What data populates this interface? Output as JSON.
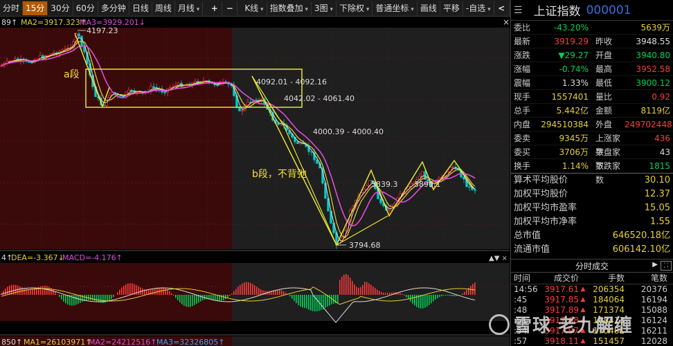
{
  "toolbar": {
    "items": [
      "分时",
      "15分",
      "30分",
      "60分",
      "多分钟",
      "日线",
      "周线",
      "月线"
    ],
    "active_index": 1,
    "plus": "+",
    "minus": "−",
    "kline": "K线",
    "overlay": "指数叠加",
    "three": "3图",
    "adjust": "下除权",
    "coord": "普通坐标",
    "draw": "画线",
    "pan": "平移",
    "select": "-自选",
    "back": "<",
    "fwd": ">"
  },
  "main_chart": {
    "ma_label_1": "89↑",
    "ma_label_2": "MA2=3917.323↑",
    "ma_label_3": "MA3=3929.201↓",
    "close_x": "×",
    "price_labels": {
      "high": "4197.23",
      "low": "3794.68",
      "l1": "4092.01 - 4092.16",
      "l2": "4042.02 - 4061.40",
      "l3": "4000.39 - 4000.40",
      "l4": "3839.3",
      "l5": "3890.1"
    },
    "annotation_a": "a段",
    "annotation_b": "b段，不背弛"
  },
  "macd": {
    "label_1": "4↑",
    "label_2": "DEA=-3.367↓",
    "label_3": "MACD=-4.176↑"
  },
  "volume": {
    "label_1": "850↑",
    "label_2": "MA1=26103971↑",
    "label_3": "MA2=24212516↑",
    "label_4": "MA3=32326805↑"
  },
  "panel": {
    "menu_icon": "☰",
    "name": "上证指数",
    "code": "000001",
    "quotes": [
      {
        "l1": "委比",
        "v1": "-43.20%",
        "c1": "green",
        "l2": "",
        "v2": "5639万",
        "c2": "yellow"
      },
      {
        "l1": "最新",
        "v1": "3919.29",
        "c1": "red",
        "l2": "昨收",
        "v2": "3948.55",
        "c2": "white"
      },
      {
        "l1": "涨跌",
        "v1": "▼29.27",
        "c1": "green",
        "l2": "开盘",
        "v2": "3940.80",
        "c2": "green"
      },
      {
        "l1": "涨幅",
        "v1": "-0.74%",
        "c1": "green",
        "l2": "最高",
        "v2": "3952.58",
        "c2": "red"
      },
      {
        "l1": "震幅",
        "v1": "1.33%",
        "c1": "white",
        "l2": "最低",
        "v2": "3900.12",
        "c2": "green"
      },
      {
        "l1": "现手",
        "v1": "1557401",
        "c1": "yellow",
        "l2": "量比",
        "v2": "0.92",
        "c2": "red"
      },
      {
        "l1": "总手",
        "v1": "5.442亿",
        "c1": "yellow",
        "l2": "金额",
        "v2": "8119亿",
        "c2": "yellow"
      },
      {
        "l1": "内盘",
        "v1": "294510384",
        "c1": "yellow",
        "l2": "外盘",
        "v2": "249702448",
        "c2": "red"
      },
      {
        "l1": "委卖",
        "v1": "9345万",
        "c1": "yellow",
        "l2": "上涨家数",
        "v2": "436",
        "c2": "red"
      },
      {
        "l1": "委买",
        "v1": "3706万",
        "c1": "yellow",
        "l2": "平盘家数",
        "v2": "43",
        "c2": "white"
      },
      {
        "l1": "换手",
        "v1": "1.14%",
        "c1": "yellow",
        "l2": "下跌家数",
        "v2": "1815",
        "c2": "green"
      }
    ],
    "stats": [
      {
        "label": "算术平均股价",
        "value": "30.10"
      },
      {
        "label": "加权平均股价",
        "value": "12.37"
      },
      {
        "label": "加权平均市盈率",
        "value": "15.05"
      },
      {
        "label": "加权平均市净率",
        "value": "1.55"
      },
      {
        "label": "总市值",
        "value": "646520.18亿"
      },
      {
        "label": "流通市值",
        "value": "606142.10亿"
      }
    ],
    "trades_title": "分时成交",
    "trades_arrow": "▶",
    "trades_fs": "⛶",
    "trade_headers": [
      "时间",
      "成交价",
      "手数",
      "笔数"
    ],
    "trades": [
      {
        "t": "14:56",
        "p": "3917.61",
        "a": "▲",
        "v": "206354",
        "n": "20376"
      },
      {
        "t": ":45",
        "p": "3917.85",
        "a": "▲",
        "v": "184064",
        "n": "16194"
      },
      {
        "t": ":48",
        "p": "3917.89",
        "a": "▲",
        "v": "171374",
        "n": "15088"
      },
      {
        "t": ":51",
        "p": "3917.68",
        "a": "▲",
        "v": "168413",
        "n": "16124"
      },
      {
        "t": ":54",
        "p": "3917.97",
        "a": "▲",
        "v": "170481",
        "n": "16211"
      },
      {
        "t": ":57",
        "p": "3918.11",
        "a": "▲",
        "v": "151457",
        "n": "12028"
      }
    ]
  },
  "watermark": "雪球 老九解缠",
  "colors": {
    "up": "#ff3b3b",
    "down": "#00d15a",
    "yellow": "#e5d033",
    "magenta": "#e04be0",
    "code_blue": "#3a6fd8",
    "active_tab": "#b35b00"
  }
}
